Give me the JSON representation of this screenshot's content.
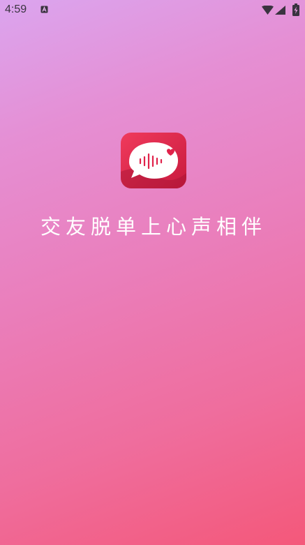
{
  "status_bar": {
    "time": "4:59",
    "notification_icon": "a-box-icon",
    "wifi_icon": "wifi-icon",
    "signal_icon": "cell-signal-icon",
    "battery_icon": "battery-charging-icon"
  },
  "splash": {
    "app_icon": "voice-chat-bubble-heart-icon",
    "tagline": "交友脱单上心声相伴"
  },
  "colors": {
    "gradient_start": "#dba5ef",
    "gradient_end": "#f4587a",
    "icon_red": "#e0224a",
    "text": "#ffffff"
  }
}
